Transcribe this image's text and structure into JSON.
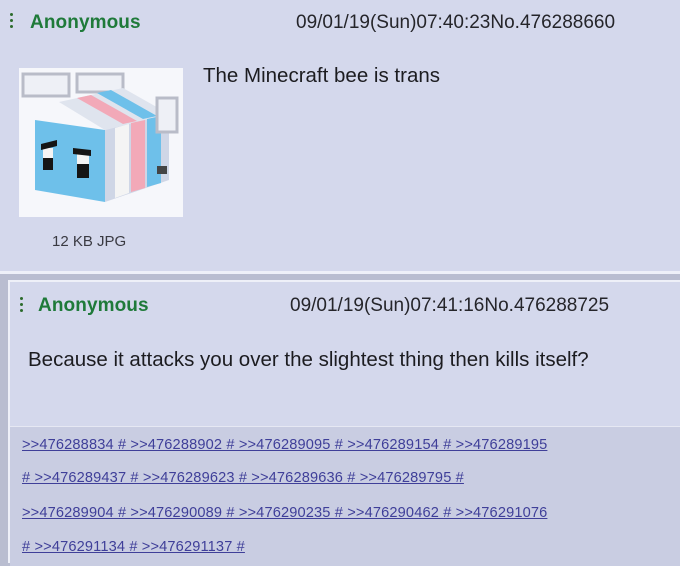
{
  "posts": [
    {
      "name": "Anonymous",
      "datetime": "09/01/19(Sun)07:40:23",
      "number": "No.476288660",
      "comment": "The Minecraft bee is trans",
      "file": {
        "info": "12 KB JPG",
        "icon": "bee-image-thumbnail"
      }
    },
    {
      "name": "Anonymous",
      "datetime": "09/01/19(Sun)07:41:16",
      "number": "No.476288725",
      "comment": "Because it attacks you over the slightest thing then kills itself?",
      "reply_lines": [
        ">>476288834 # >>476288902 # >>476289095 # >>476289154 # >>476289195",
        "# >>476289437 # >>476289623 # >>476289636 # >>476289795 #",
        ">>476289904 # >>476290089 # >>476290235 # >>476290462 # >>476291076",
        "# >>476291134 # >>476291137 #"
      ]
    }
  ],
  "colors": {
    "post_background": "#d4d8ec",
    "name": "#1f7a3a",
    "reply_link": "#3f3f99",
    "bee_light_blue": "#6ec0ea",
    "bee_pink": "#f2a9b8",
    "bee_white": "#f4f4f4"
  }
}
